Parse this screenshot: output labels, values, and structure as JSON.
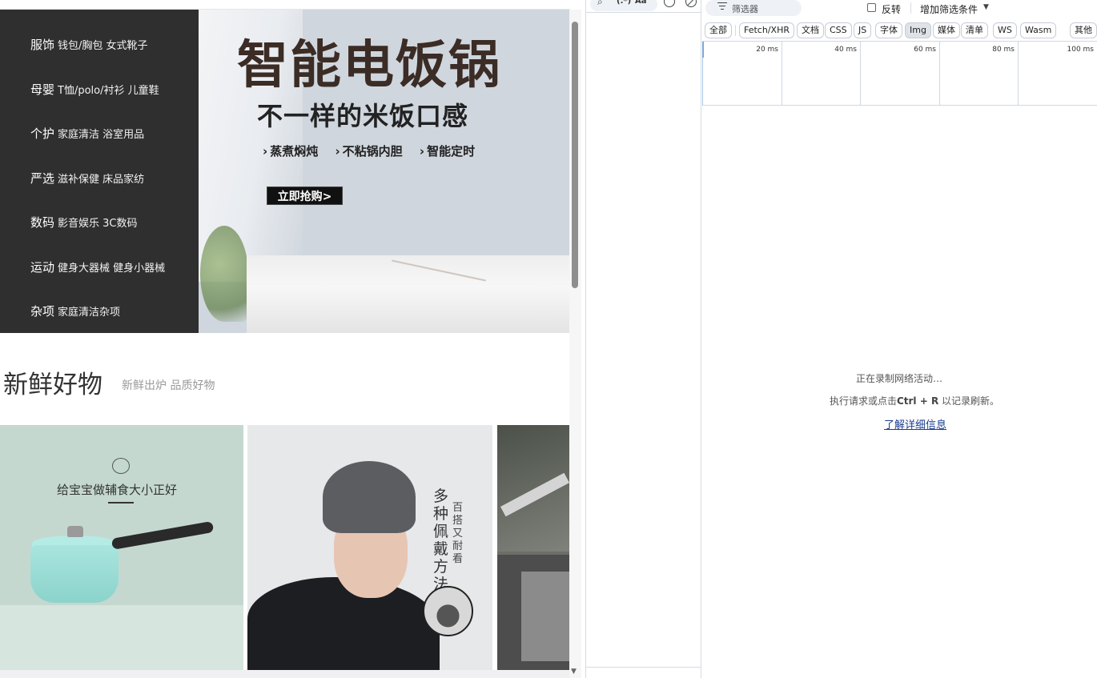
{
  "page": {
    "categories": [
      {
        "name": "服饰",
        "subs": "钱包/胸包 女式靴子"
      },
      {
        "name": "母婴",
        "subs": "T恤/polo/衬衫 儿童鞋"
      },
      {
        "name": "个护",
        "subs": "家庭清洁 浴室用品"
      },
      {
        "name": "严选",
        "subs": "滋补保健 床品家纺"
      },
      {
        "name": "数码",
        "subs": "影音娱乐 3C数码"
      },
      {
        "name": "运动",
        "subs": "健身大器械 健身小器械"
      },
      {
        "name": "杂项",
        "subs": "家庭清洁杂项"
      }
    ],
    "banner": {
      "title": "智能电饭锅",
      "subtitle": "不一样的米饭口感",
      "features": [
        "蒸煮焖炖",
        "不粘锅内胆",
        "智能定时"
      ],
      "cta": "立即抢购>"
    },
    "section": {
      "title": "新鲜好物",
      "subtitle": "新鲜出炉 品质好物"
    },
    "products": [
      {
        "caption": "给宝宝做辅食大小正好"
      },
      {
        "caption_main": "多种佩戴方法",
        "caption_side": "百搭又耐看"
      }
    ]
  },
  "devtools": {
    "search": {
      "regex_label": "(.*)",
      "case_label": "Aa"
    },
    "filter": {
      "placeholder": "筛选器",
      "invert_label": "反转",
      "more_filters_label": "增加筛选条件"
    },
    "type_filters": [
      "全部",
      "Fetch/XHR",
      "文档",
      "CSS",
      "JS",
      "字体",
      "Img",
      "媒体",
      "清单",
      "WS",
      "Wasm",
      "其他"
    ],
    "active_type": "Img",
    "timeline_ticks": [
      "20 ms",
      "40 ms",
      "60 ms",
      "80 ms",
      "100 ms"
    ],
    "status": {
      "recording": "正在录制网络活动…",
      "hint_prefix": "执行请求或点击",
      "hint_key": "Ctrl + R",
      "hint_suffix": "以记录刷新。",
      "learn_more": "了解详细信息"
    }
  }
}
